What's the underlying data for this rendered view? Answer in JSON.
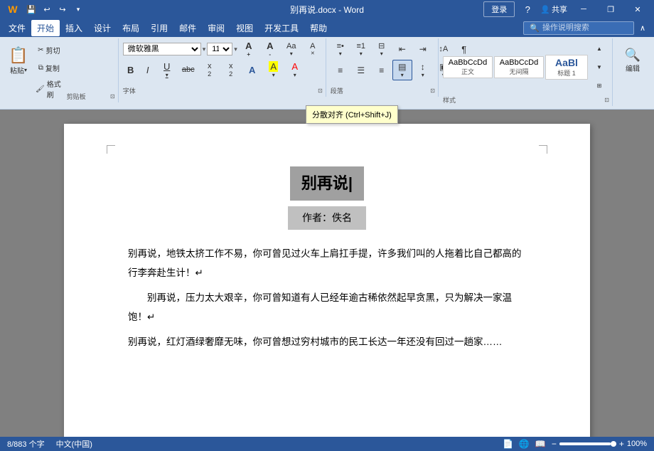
{
  "titlebar": {
    "filename": "别再说.docx - Word",
    "login_label": "登录",
    "minimize_icon": "─",
    "maximize_icon": "□",
    "close_icon": "✕",
    "restore_icon": "❐",
    "quick_save": "💾",
    "quick_undo": "↩",
    "quick_redo": "↪",
    "quick_more": "▾",
    "share_label": "共享",
    "help_icon": "?"
  },
  "menubar": {
    "items": [
      "文件",
      "开始",
      "插入",
      "设计",
      "布局",
      "引用",
      "邮件",
      "审阅",
      "视图",
      "开发工具",
      "帮助"
    ],
    "active": "开始"
  },
  "ribbon": {
    "clipboard": {
      "label": "剪贴板",
      "paste_label": "粘贴",
      "cut_label": "剪切",
      "copy_label": "复制",
      "format_painter_label": "格式刷"
    },
    "font": {
      "label": "字体",
      "font_name": "微软雅黑",
      "font_size": "11",
      "bold": "B",
      "italic": "I",
      "underline": "U",
      "strikethrough": "abc",
      "subscript": "x₂",
      "superscript": "x²",
      "font_color": "A",
      "highlight": "A",
      "clear_format": "A",
      "grow_font": "A↑",
      "shrink_font": "A↓",
      "change_case": "Aa",
      "text_effect": "A"
    },
    "paragraph": {
      "label": "段落",
      "bullets": "≡•",
      "numbering": "≡1",
      "multilevel": "≡≡",
      "decrease_indent": "⇤",
      "increase_indent": "⇥",
      "sort": "↕A",
      "show_marks": "¶",
      "align_left": "≡",
      "align_center": "≡",
      "align_right": "≡",
      "justify": "≡",
      "line_spacing": "↕",
      "shading": "▤",
      "borders": "⊞"
    },
    "styles": {
      "label": "样式",
      "items": [
        "正文",
        "无间隔",
        "标题 1"
      ],
      "style_samples": [
        {
          "name": "AaBbCcDd",
          "label": "正文"
        },
        {
          "name": "AaBbCcDd",
          "label": "无间隔"
        },
        {
          "name": "AaBl",
          "label": "标题 1"
        }
      ]
    },
    "editing": {
      "label": "编辑",
      "search_icon": "🔍"
    }
  },
  "search": {
    "placeholder": "操作说明搜索"
  },
  "document": {
    "title": "别再说",
    "author_label": "作者：佚名",
    "paragraphs": [
      {
        "text": "别再说，地铁太挤工作不易，你可曾见过火车上肩扛手提，许多我们叫的人拖着比自己都高的行李奔赴生计！↵",
        "indent": false
      },
      {
        "text": "别再说，压力太大艰辛，你可曾知道有人已经年逾古稀依然起早贪黑，只为解决一家温饱！↵",
        "indent": true
      },
      {
        "text": "别再说，红灯酒绿奢靡无味，你可曾想过穷村城市的民工长达一年还没有回过一趟家……",
        "indent": false,
        "partial": true
      }
    ]
  },
  "statusbar": {
    "word_count": "8/883 个字",
    "language": "中文(中国)",
    "zoom_percent": "100%"
  },
  "tooltip": {
    "visible": true,
    "text": "分散对齐 (Ctrl+Shift+J)"
  }
}
